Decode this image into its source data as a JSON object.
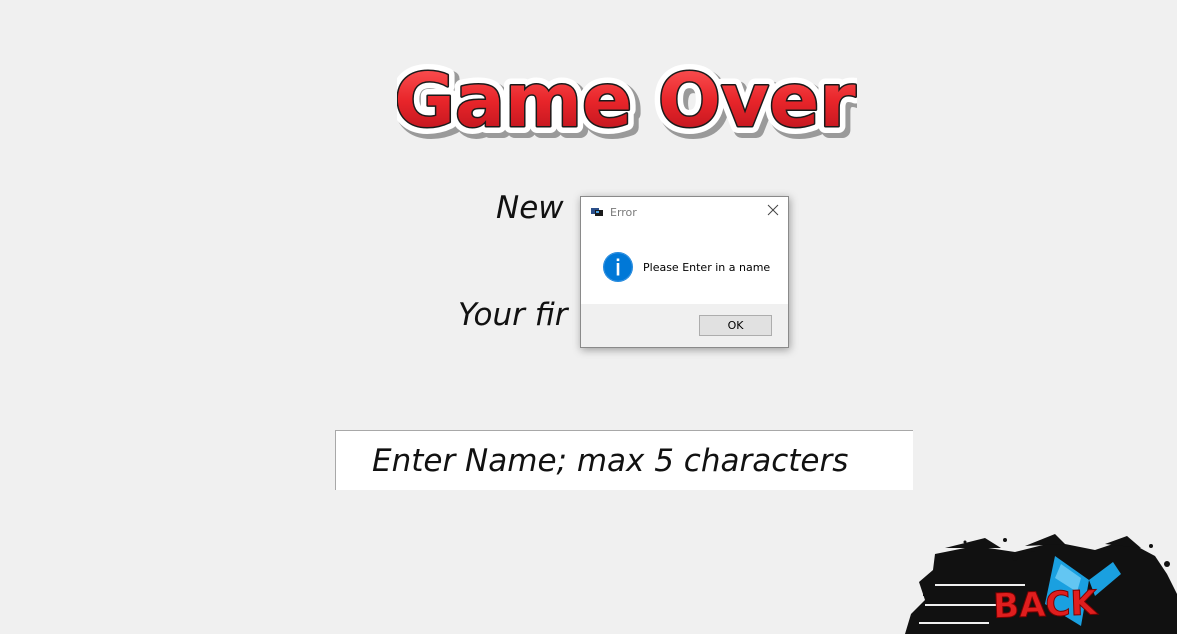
{
  "game": {
    "title": "Game Over",
    "line_new": "New",
    "line_your": "Your fir",
    "name_input_placeholder": "Enter Name; max 5 characters",
    "name_input_value": ""
  },
  "dialog": {
    "title": "Error",
    "message": "Please Enter in a name",
    "ok_label": "OK",
    "icon": "info-icon",
    "close_icon": "close-icon"
  },
  "back_button": {
    "label": "BACK"
  },
  "colors": {
    "background": "#f0f0f0",
    "title_red": "#e8252a",
    "back_red": "#e01e1e",
    "back_blue": "#1aa0e0",
    "info_blue": "#0078d7"
  }
}
